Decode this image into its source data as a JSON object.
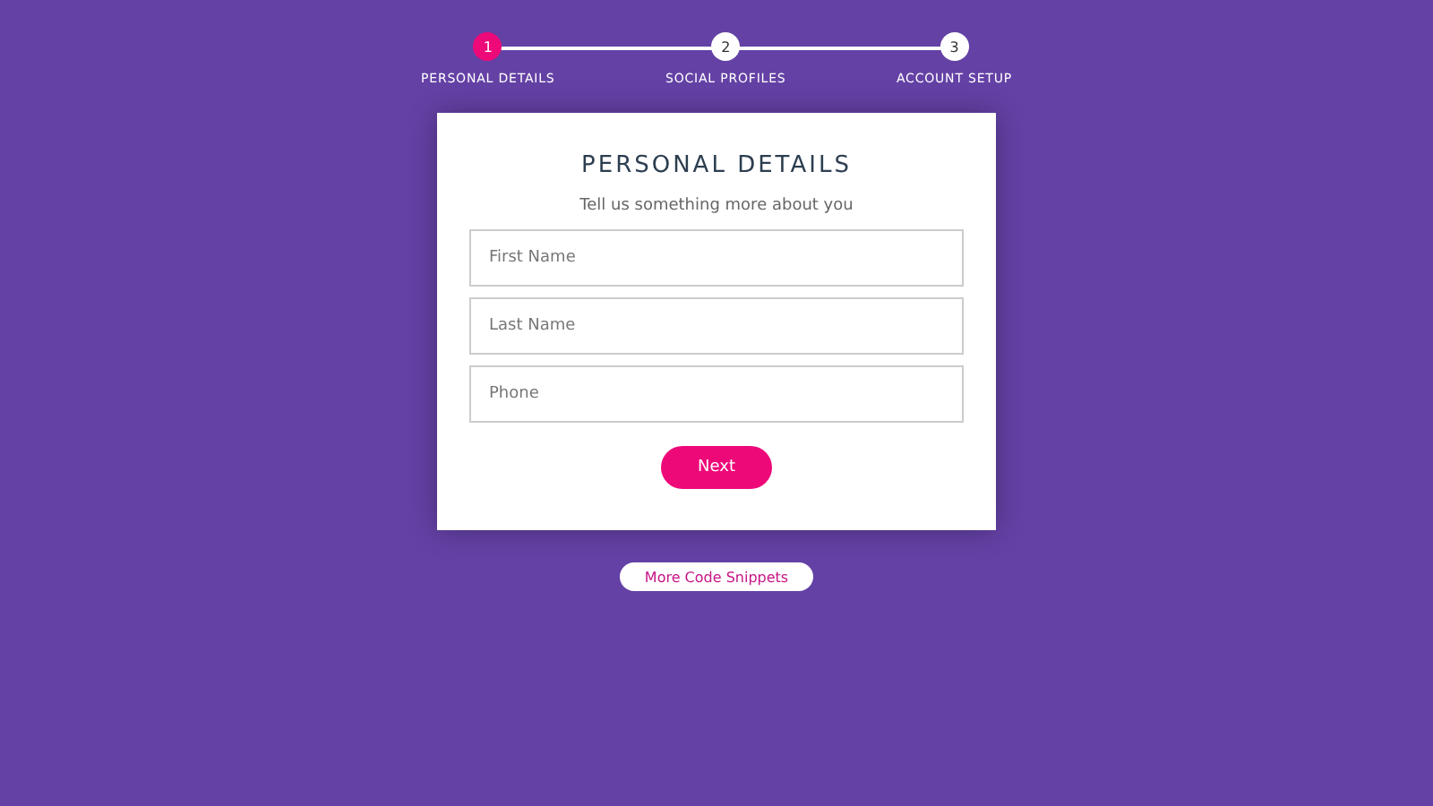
{
  "steps": [
    {
      "number": "1",
      "label": "PERSONAL DETAILS",
      "selected": true
    },
    {
      "number": "2",
      "label": "SOCIAL PROFILES",
      "selected": false
    },
    {
      "number": "3",
      "label": "ACCOUNT SETUP",
      "selected": false
    }
  ],
  "form": {
    "title": "PERSONAL DETAILS",
    "subtitle": "Tell us something more about you",
    "fields": [
      {
        "placeholder": "First Name"
      },
      {
        "placeholder": "Last Name"
      },
      {
        "placeholder": "Phone"
      }
    ],
    "button": "Next"
  },
  "link_button": "More Code Snippets"
}
